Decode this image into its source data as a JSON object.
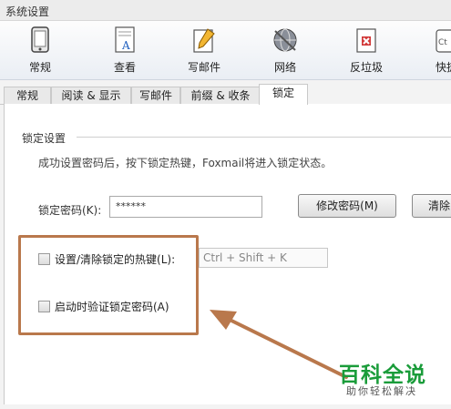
{
  "window": {
    "title": "系统设置"
  },
  "toolbar": {
    "items": [
      {
        "label": "常规",
        "icon": "phone-icon"
      },
      {
        "label": "查看",
        "icon": "document-view-icon"
      },
      {
        "label": "写邮件",
        "icon": "compose-pencil-icon"
      },
      {
        "label": "网络",
        "icon": "globe-network-icon"
      },
      {
        "label": "反垃圾",
        "icon": "trash-x-icon"
      },
      {
        "label": "快捷",
        "icon": "keyboard-shortcut-icon"
      }
    ]
  },
  "tabs": [
    {
      "label": "常规"
    },
    {
      "label": "阅读 & 显示"
    },
    {
      "label": "写邮件"
    },
    {
      "label": "前缀 & 收条"
    },
    {
      "label": "锁定",
      "active": true
    }
  ],
  "lock": {
    "group_label": "锁定设置",
    "description": "成功设置密码后，按下锁定热键，Foxmail将进入锁定状态。",
    "password_label": "锁定密码(K):",
    "password_value": "******",
    "change_button": "修改密码(M)",
    "clear_button": "清除",
    "hotkey_checkbox_label": "设置/清除锁定的热键(L):",
    "hotkey_checked": false,
    "hotkey_value": "Ctrl + Shift + K",
    "verify_checkbox_label": "启动时验证锁定密码(A)",
    "verify_checked": false
  },
  "watermark": {
    "brand": "百科全说",
    "tagline": "助你轻松解决"
  },
  "colors": {
    "highlight": "#b9784c",
    "brand_green": "#1a9c3a"
  }
}
